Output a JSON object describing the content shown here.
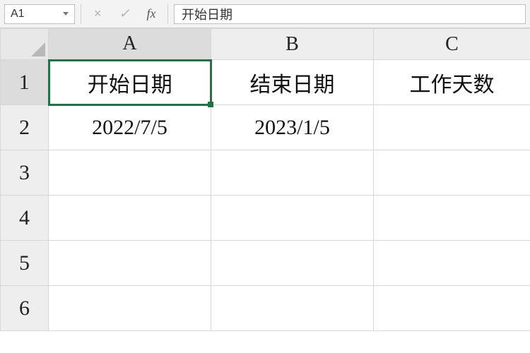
{
  "formula_bar": {
    "name_box": "A1",
    "cancel_glyph": "×",
    "confirm_glyph": "✓",
    "fx_label": "fx",
    "value": "开始日期"
  },
  "columns": [
    "A",
    "B",
    "C"
  ],
  "rows": [
    "1",
    "2",
    "3",
    "4",
    "5",
    "6"
  ],
  "active_cell": {
    "row": 0,
    "col": 0
  },
  "cells": {
    "A1": "开始日期",
    "B1": "结束日期",
    "C1": "工作天数",
    "A2": "2022/7/5",
    "B2": "2023/1/5",
    "C2": "",
    "A3": "",
    "B3": "",
    "C3": "",
    "A4": "",
    "B4": "",
    "C4": "",
    "A5": "",
    "B5": "",
    "C5": "",
    "A6": "",
    "B6": "",
    "C6": ""
  }
}
